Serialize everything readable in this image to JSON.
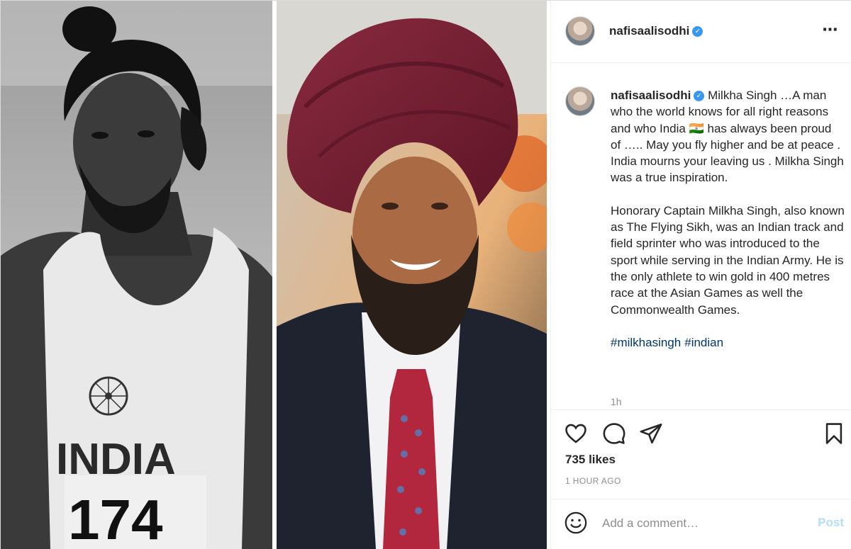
{
  "header": {
    "username": "nafisaalisodhi",
    "more_icon": "⋯"
  },
  "media": {
    "left_photo_jersey_text": "INDIA",
    "left_photo_bib_number": "174"
  },
  "caption": {
    "username": "nafisaalisodhi",
    "text_part1": " Milkha Singh …A man who the world knows for all right reasons and who India ",
    "flag_emoji": "🇮🇳",
    "text_part2": " has always been proud of ….. May you fly higher and be at peace . India mourns your leaving us . Milkha Singh was a true inspiration.",
    "paragraph2": "Honorary Captain Milkha Singh, also known as The Flying Sikh, was an Indian track and field sprinter who was introduced to the sport while serving in the Indian Army. He is the only athlete to win gold in 400 metres race at the Asian Games as well the Commonwealth Games.",
    "hashtags": [
      "#milkhasingh",
      "#indian"
    ],
    "timestamp": "1h"
  },
  "actions": {
    "icons": [
      "heart-icon",
      "comment-icon",
      "share-icon",
      "bookmark-icon"
    ],
    "likes": "735 likes",
    "time_ago": "1 HOUR AGO"
  },
  "comment": {
    "placeholder": "Add a comment…",
    "post_label": "Post",
    "emoji_icon": "smiley-icon"
  },
  "colors": {
    "verified": "#3897f0",
    "hashtag": "#00376b",
    "post_disabled": "#b2dffc",
    "muted": "#8e8e8e",
    "turban": "#7a1f33"
  }
}
